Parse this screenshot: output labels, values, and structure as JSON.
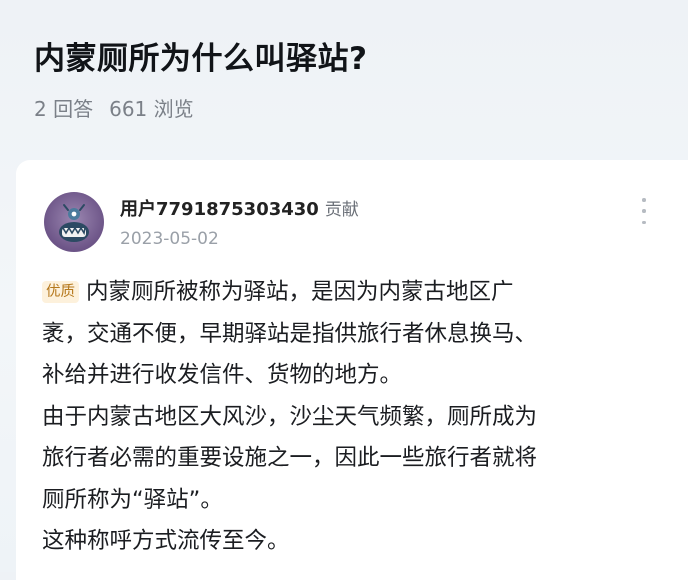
{
  "question": {
    "title": "内蒙厕所为什么叫驿站?",
    "answers_count": "2 回答",
    "views_count": "661 浏览"
  },
  "answer": {
    "author": {
      "name": "用户7791875303430",
      "role": "贡献",
      "date": "2023-05-02",
      "avatar_icon": "monster-avatar-icon"
    },
    "quality_badge": "优质",
    "lines": [
      "内蒙厕所被称为驿站，是因为内蒙古地区广",
      "袤，交通不便，早期驿站是指供旅行者休息换马、",
      "补给并进行收发信件、货物的地方。",
      "由于内蒙古地区大风沙，沙尘天气频繁，厕所成为",
      "旅行者必需的重要设施之一，因此一些旅行者就将",
      "厕所称为“驿站”。",
      "这种称呼方式流传至今。"
    ],
    "more_icon": "more-vertical-icon"
  },
  "colors": {
    "page_background": "#eef2f6",
    "card_background": "#ffffff",
    "badge_text": "#b5781c",
    "badge_background": "#fdf1dc",
    "secondary_text": "#7b8088"
  }
}
